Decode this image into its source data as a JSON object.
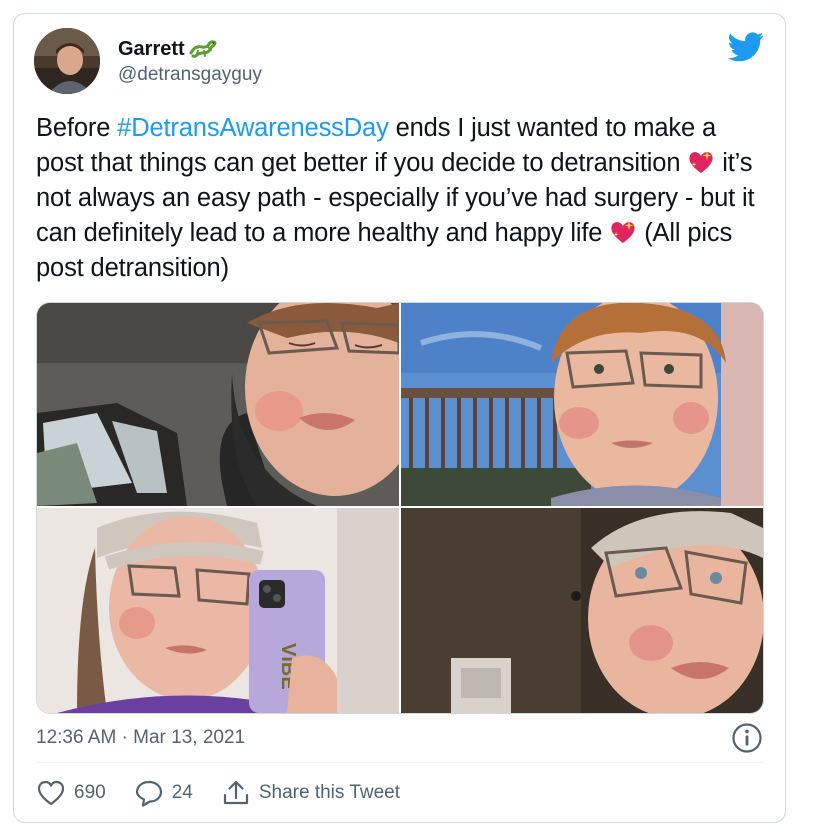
{
  "tweet": {
    "display_name": "Garrett",
    "name_emoji": "lizard-emoji",
    "handle": "@detransgayguy",
    "text_parts": {
      "before": "Before ",
      "hashtag": "#DetransAwarenessDay",
      "p1": " ends I just wanted to make a post that things can get better if you decide to detransition ",
      "p2": " it’s not always an easy path - especially if you’ve had surgery - but it can definitely lead to a more healthy and happy life ",
      "p3": " (All pics post detransition)"
    },
    "text_emoji": "sparkling-heart-emoji",
    "timestamp": "12:36 AM · Mar 13, 2021"
  },
  "actions": {
    "likes": "690",
    "replies": "24",
    "share_label": "Share this Tweet"
  },
  "media": {
    "photos": [
      "selfie-in-car",
      "selfie-on-balcony",
      "mirror-selfie-with-phone",
      "selfie-indoors"
    ],
    "phone_case_text": "VIBE"
  },
  "colors": {
    "accent": "#1d9bf0",
    "heart_emoji": "#e0245e",
    "text": "#0f1419",
    "secondary": "#536471",
    "border": "#cfd9de"
  }
}
